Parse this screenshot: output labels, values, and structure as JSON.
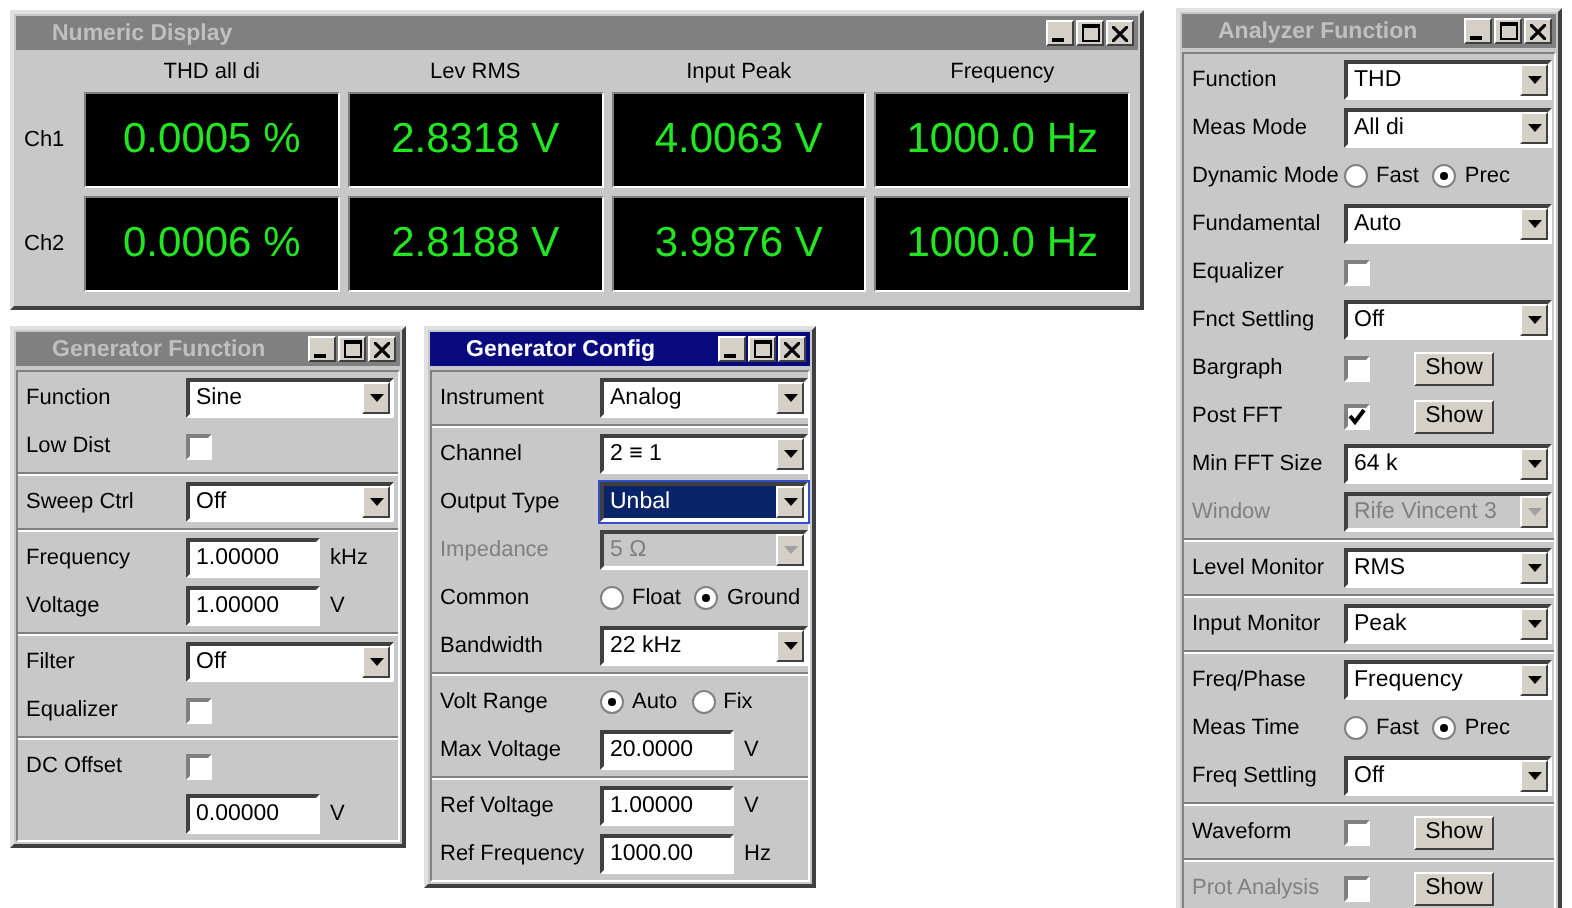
{
  "windows": [
    {
      "kind": "numeric",
      "title": "Numeric Display",
      "active": false,
      "columns": [
        "THD all di",
        "Lev RMS",
        "Input Peak",
        "Frequency"
      ],
      "rows": [
        {
          "label": "Ch1",
          "values": [
            "0.0005 %",
            "2.8318 V",
            "4.0063 V",
            "1000.0 Hz"
          ]
        },
        {
          "label": "Ch2",
          "values": [
            "0.0006 %",
            "2.8188 V",
            "3.9876 V",
            "1000.0 Hz"
          ]
        }
      ]
    },
    {
      "kind": "panel",
      "title": "Generator Function",
      "active": false,
      "sections": [
        {
          "rows": [
            {
              "kind": "select",
              "label": "Function",
              "value": "Sine",
              "disabled": false,
              "focused": false
            },
            {
              "kind": "check",
              "label": "Low Dist",
              "checked": false,
              "disabled": false
            }
          ]
        },
        {
          "rows": [
            {
              "kind": "select",
              "label": "Sweep Ctrl",
              "value": "Off",
              "disabled": false,
              "focused": false
            }
          ]
        },
        {
          "rows": [
            {
              "kind": "number",
              "label": "Frequency",
              "value": "1.00000",
              "unit": "kHz"
            },
            {
              "kind": "number",
              "label": "Voltage",
              "value": "1.00000",
              "unit": "V"
            }
          ]
        },
        {
          "rows": [
            {
              "kind": "select",
              "label": "Filter",
              "value": "Off",
              "disabled": false,
              "focused": false
            },
            {
              "kind": "check",
              "label": "Equalizer",
              "checked": false,
              "disabled": false
            }
          ]
        },
        {
          "rows": [
            {
              "kind": "check",
              "label": "DC Offset",
              "checked": false,
              "disabled": false
            },
            {
              "kind": "number",
              "value": "0.00000",
              "unit": "V"
            }
          ]
        }
      ]
    },
    {
      "kind": "panel",
      "title": "Generator Config",
      "active": true,
      "sections": [
        {
          "rows": [
            {
              "kind": "select",
              "label": "Instrument",
              "value": "Analog",
              "disabled": false,
              "focused": false
            }
          ]
        },
        {
          "rows": [
            {
              "kind": "select",
              "label": "Channel",
              "value": "2 ≡ 1",
              "disabled": false,
              "focused": false
            },
            {
              "kind": "select",
              "label": "Output Type",
              "value": "Unbal",
              "disabled": false,
              "focused": true
            },
            {
              "kind": "select",
              "label": "Impedance",
              "value": "5 Ω",
              "disabled": true,
              "focused": false
            },
            {
              "kind": "radio",
              "label": "Common",
              "options": [
                {
                  "label": "Float",
                  "selected": false
                },
                {
                  "label": "Ground",
                  "selected": true
                }
              ]
            },
            {
              "kind": "select",
              "label": "Bandwidth",
              "value": "22 kHz",
              "disabled": false,
              "focused": false
            }
          ]
        },
        {
          "rows": [
            {
              "kind": "radio",
              "label": "Volt Range",
              "options": [
                {
                  "label": "Auto",
                  "selected": true
                },
                {
                  "label": "Fix",
                  "selected": false
                }
              ]
            },
            {
              "kind": "number",
              "label": "Max Voltage",
              "value": "20.0000",
              "unit": "V"
            }
          ]
        },
        {
          "rows": [
            {
              "kind": "number",
              "label": "Ref Voltage",
              "value": "1.00000",
              "unit": "V"
            },
            {
              "kind": "number",
              "label": "Ref Frequency",
              "value": "1000.00",
              "unit": "Hz"
            }
          ]
        }
      ]
    },
    {
      "kind": "panel",
      "title": "Analyzer Function",
      "active": false,
      "sections": [
        {
          "rows": [
            {
              "kind": "select",
              "label": "Function",
              "value": "THD",
              "disabled": false,
              "focused": false
            },
            {
              "kind": "select",
              "label": "Meas Mode",
              "value": "All di",
              "disabled": false,
              "focused": false
            },
            {
              "kind": "radio",
              "label": "Dynamic Mode",
              "options": [
                {
                  "label": "Fast",
                  "selected": false
                },
                {
                  "label": "Prec",
                  "selected": true
                }
              ]
            },
            {
              "kind": "select",
              "label": "Fundamental",
              "value": "Auto",
              "disabled": false,
              "focused": false
            },
            {
              "kind": "check",
              "label": "Equalizer",
              "checked": false,
              "disabled": false
            },
            {
              "kind": "select",
              "label": "Fnct Settling",
              "value": "Off",
              "disabled": false,
              "focused": false
            },
            {
              "kind": "check",
              "label": "Bargraph",
              "checked": false,
              "disabled": false,
              "button": "Show"
            },
            {
              "kind": "check",
              "label": "Post FFT",
              "checked": true,
              "disabled": false,
              "button": "Show"
            },
            {
              "kind": "select",
              "label": "Min FFT Size",
              "value": "64 k",
              "disabled": false,
              "focused": false
            },
            {
              "kind": "select",
              "label": "Window",
              "value": "Rife Vincent 3",
              "disabled": true,
              "focused": false
            }
          ]
        },
        {
          "rows": [
            {
              "kind": "select",
              "label": "Level Monitor",
              "value": "RMS",
              "disabled": false,
              "focused": false
            }
          ]
        },
        {
          "rows": [
            {
              "kind": "select",
              "label": "Input Monitor",
              "value": "Peak",
              "disabled": false,
              "focused": false
            }
          ]
        },
        {
          "rows": [
            {
              "kind": "select",
              "label": "Freq/Phase",
              "value": "Frequency",
              "disabled": false,
              "focused": false
            },
            {
              "kind": "radio",
              "label": "Meas Time",
              "options": [
                {
                  "label": "Fast",
                  "selected": false
                },
                {
                  "label": "Prec",
                  "selected": true
                }
              ]
            },
            {
              "kind": "select",
              "label": "Freq Settling",
              "value": "Off",
              "disabled": false,
              "focused": false
            }
          ]
        },
        {
          "rows": [
            {
              "kind": "check",
              "label": "Waveform",
              "checked": false,
              "disabled": false,
              "button": "Show"
            }
          ]
        },
        {
          "rows": [
            {
              "kind": "check",
              "label": "Prot Analysis",
              "checked": false,
              "disabled": true,
              "button": "Show"
            }
          ]
        }
      ]
    }
  ]
}
